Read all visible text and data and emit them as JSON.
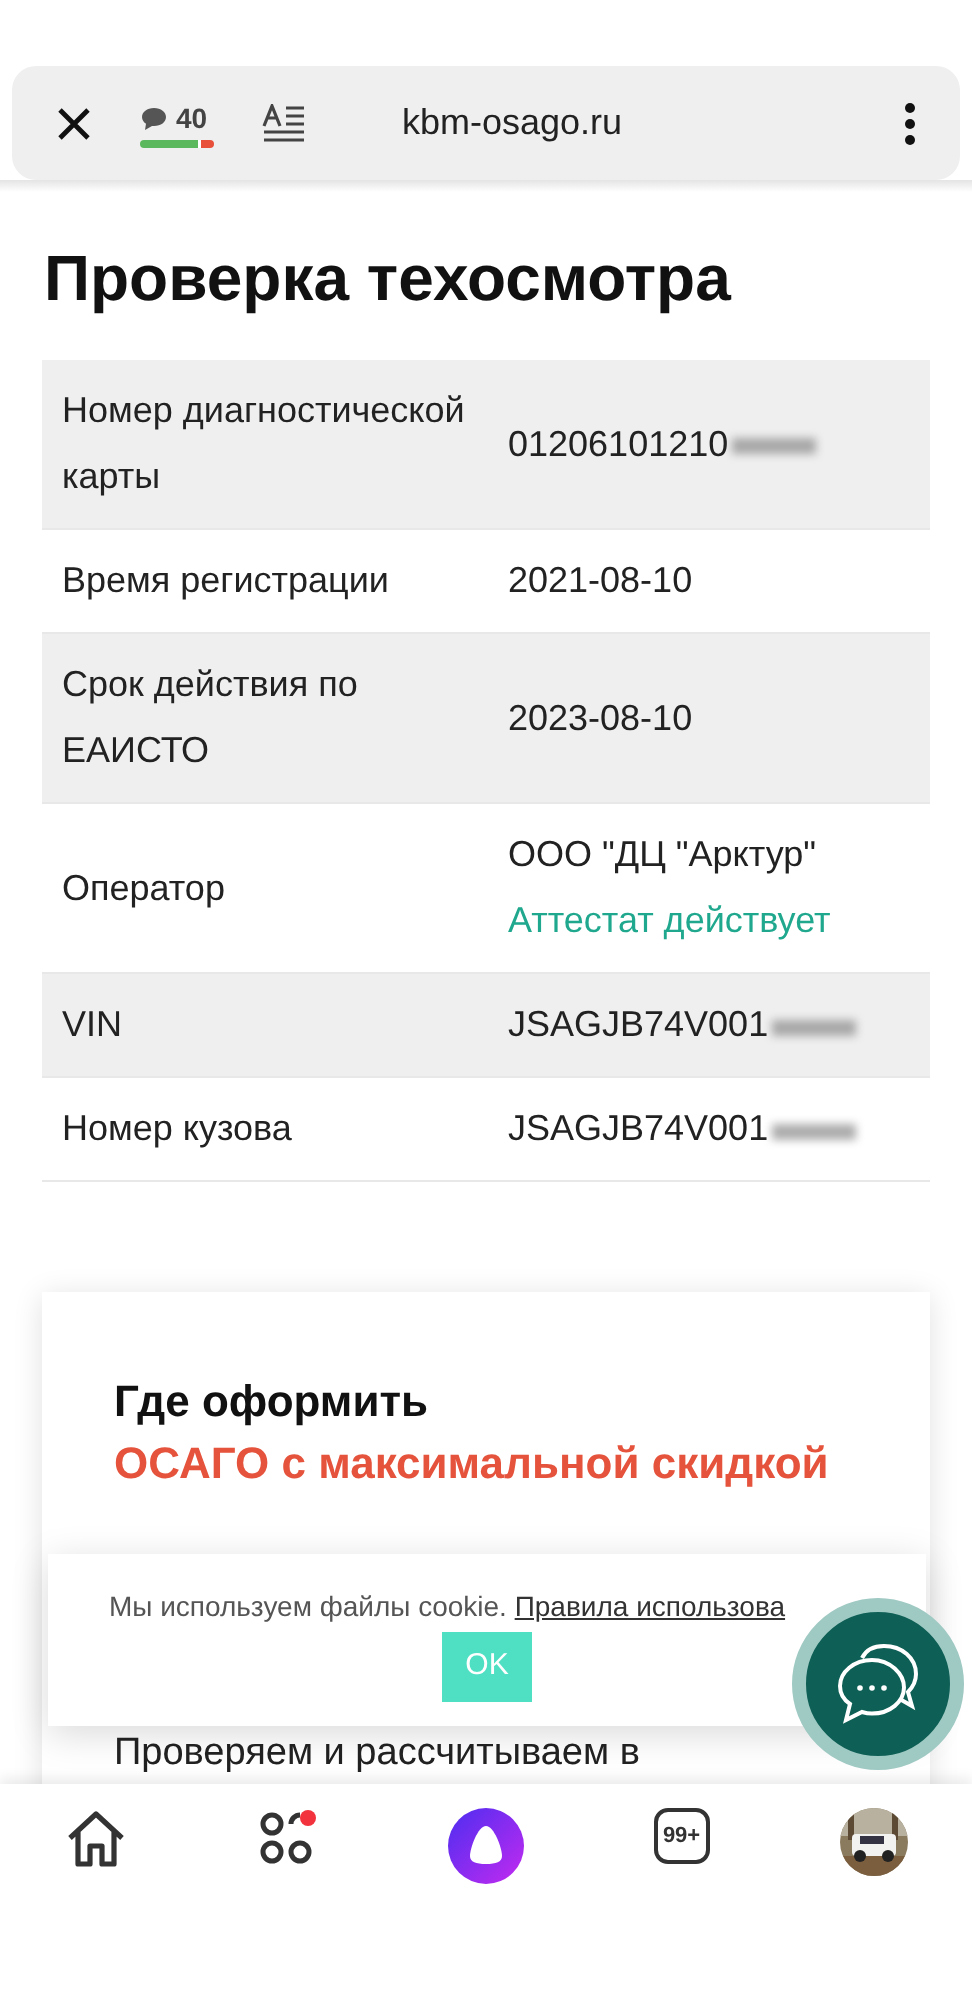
{
  "browser_bar": {
    "comments_count": "40",
    "url": "kbm-osago.ru"
  },
  "title": "Проверка техосмотра",
  "rows": [
    {
      "label": "Номер диагностической карты",
      "value": "01206101210",
      "redacted": true
    },
    {
      "label": "Время регистрации",
      "value": "2021-08-10",
      "redacted": false
    },
    {
      "label": "Срок действия по ЕАИСТО",
      "value": "2023-08-10",
      "redacted": false
    },
    {
      "label": "Оператор",
      "value": "ООО \"ДЦ \"Арктур\"",
      "note": "Аттестат действует",
      "redacted": false
    },
    {
      "label": "VIN",
      "value": "JSAGJB74V001",
      "redacted": true
    },
    {
      "label": "Номер кузова",
      "value": "JSAGJB74V001",
      "redacted": true
    }
  ],
  "promo": {
    "heading": "Где оформить",
    "highlight": "ОСАГО с максимальной скидкой",
    "text": "Проверяем и рассчитываем в"
  },
  "cookie_banner": {
    "text": "Мы используем файлы cookie.",
    "link": "Правила использова",
    "button": "OK"
  },
  "bottom_nav": {
    "counter": "99+",
    "apps_notification": true
  }
}
